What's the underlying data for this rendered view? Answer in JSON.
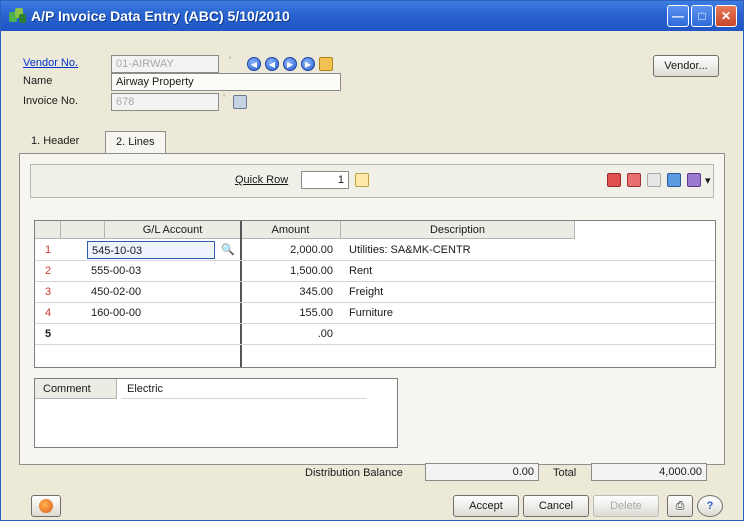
{
  "window": {
    "title": "A/P Invoice Data Entry (ABC) 5/10/2010"
  },
  "header": {
    "vendor_no_label": "Vendor No.",
    "vendor_no_value": "01-AIRWAY",
    "name_label": "Name",
    "name_value": "Airway Property",
    "invoice_no_label": "Invoice No.",
    "invoice_no_value": "678",
    "vendor_button": "Vendor..."
  },
  "tabs": [
    {
      "label": "1. Header"
    },
    {
      "label": "2. Lines"
    }
  ],
  "toolbar": {
    "quick_row_label": "Quick Row",
    "quick_row_value": "1"
  },
  "grid": {
    "columns": [
      "G/L Account",
      "Amount",
      "Description"
    ],
    "rows": [
      {
        "num": "1",
        "account": "545-10-03",
        "amount": "2,000.00",
        "description": "Utilities: SA&MK-CENTR"
      },
      {
        "num": "2",
        "account": "555-00-03",
        "amount": "1,500.00",
        "description": "Rent"
      },
      {
        "num": "3",
        "account": "450-02-00",
        "amount": "345.00",
        "description": "Freight"
      },
      {
        "num": "4",
        "account": "160-00-00",
        "amount": "155.00",
        "description": "Furniture"
      },
      {
        "num": "5",
        "account": "",
        "amount": ".00",
        "description": ""
      }
    ]
  },
  "comment": {
    "label": "Comment",
    "value": "Electric"
  },
  "totals": {
    "distribution_balance_label": "Distribution Balance",
    "distribution_balance_value": "0.00",
    "total_label": "Total",
    "total_value": "4,000.00"
  },
  "footer": {
    "accept": "Accept",
    "cancel": "Cancel",
    "delete": "Delete"
  },
  "colors": {
    "titlebar": "#2a63d0",
    "row_number": "#d0342c"
  }
}
